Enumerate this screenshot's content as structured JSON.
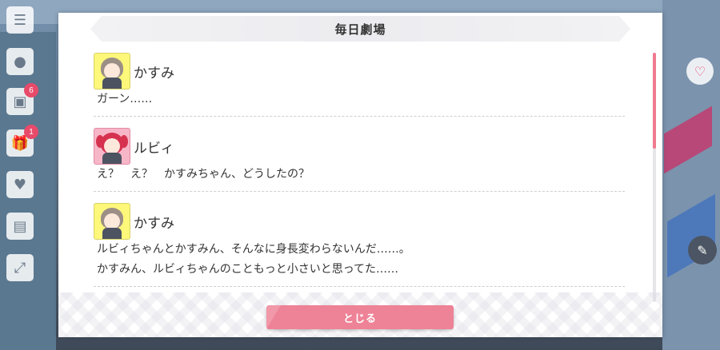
{
  "modal": {
    "title": "毎日劇場",
    "close_label": "とじる"
  },
  "dialogue": [
    {
      "speaker": "かすみ",
      "lines": [
        "ガーン……"
      ]
    },
    {
      "speaker": "ルビィ",
      "lines": [
        "え？　え？　かすみちゃん、どうしたの？"
      ]
    },
    {
      "speaker": "かすみ",
      "lines": [
        "ルビィちゃんとかすみん、そんなに身長変わらないんだ……。",
        "かすみん、ルビィちゃんのこともっと小さいと思ってた……"
      ]
    }
  ],
  "side_badges": {
    "badge1": "6",
    "badge2": "1"
  },
  "colors": {
    "accent": "#ee8296",
    "badge": "#e84a6a"
  },
  "icons": [
    "menu-icon",
    "chat-icon",
    "gift-icon",
    "heart-icon",
    "theater-icon",
    "fullscreen-icon",
    "pencil-icon"
  ]
}
